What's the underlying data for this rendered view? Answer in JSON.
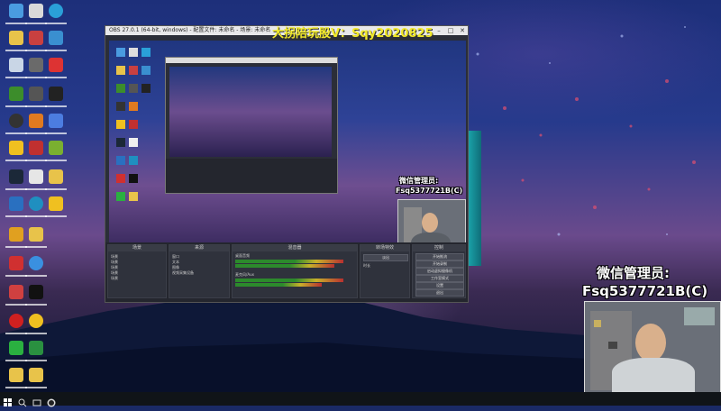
{
  "overlay": {
    "title": "大拐陪玩股V：Sqy2020825",
    "wechat_label": "微信管理员:",
    "wechat_id": "Fsq5377721B(C)"
  },
  "preview_overlay": {
    "wechat_label": "微信管理员:",
    "wechat_id": "Fsq5377721B(C)"
  },
  "obs": {
    "title_text": "OBS 27.0.1 (64-bit, windows) - 配置文件: 未命名 - 场景: 未命名",
    "docks": {
      "scenes": "场景",
      "sources": "来源",
      "mixer": "混音器",
      "transitions": "转场特效",
      "controls": "控制"
    },
    "scenes_items": [
      "场景",
      "场景",
      "场景",
      "场景",
      "场景",
      "场景"
    ],
    "sources_items": [
      "窗口",
      "文本",
      "图像",
      "视频采集设备"
    ],
    "mixer_items": [
      "桌面音频",
      "麦克风/Aux"
    ],
    "transition_value": "淡出",
    "duration_label": "时长",
    "controls": [
      "开始推流",
      "开始录制",
      "启动虚拟摄像机",
      "工作室模式",
      "设置",
      "退出"
    ]
  },
  "colors": {
    "overlay_yellow": "#f3ea2a",
    "obs_dark": "#2b2e38",
    "teal_accent": "#1aa1a8",
    "taskbar": "#101418"
  },
  "taskbar": {
    "icons": [
      "windows-start-icon",
      "search-icon",
      "task-view-icon",
      "obs-icon"
    ]
  }
}
